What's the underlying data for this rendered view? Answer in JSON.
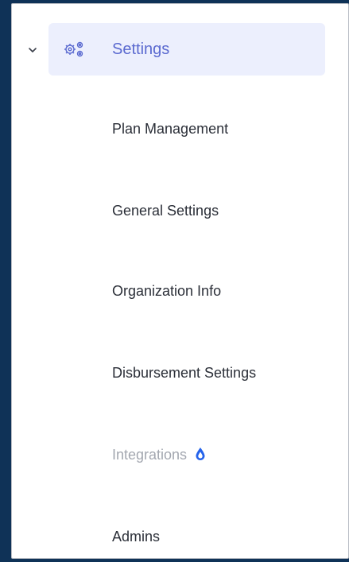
{
  "nav": {
    "section_label": "Settings",
    "section_expanded": true,
    "items": [
      {
        "label": "Plan Management",
        "disabled": false
      },
      {
        "label": "General Settings",
        "disabled": false
      },
      {
        "label": "Organization Info",
        "disabled": false
      },
      {
        "label": "Disbursement Settings",
        "disabled": false
      },
      {
        "label": "Integrations",
        "disabled": true,
        "icon": "drop-icon"
      },
      {
        "label": "Admins",
        "disabled": false
      }
    ]
  },
  "colors": {
    "background": "#0f3257",
    "accent": "#5b6ad0",
    "active_bg": "#eceffd",
    "text": "#2b2f38",
    "muted": "#a3a7b0",
    "icon_blue": "#2563eb"
  }
}
